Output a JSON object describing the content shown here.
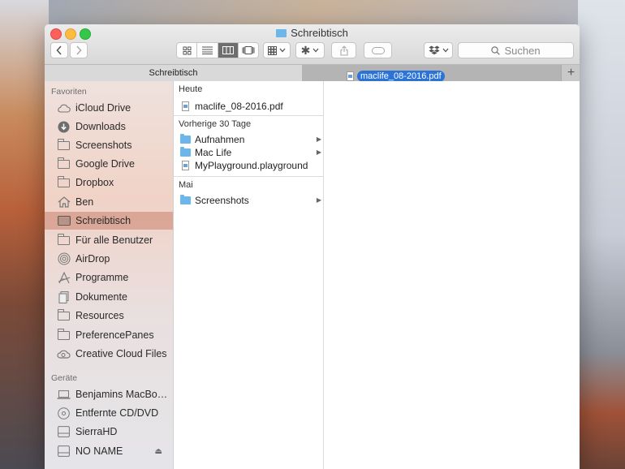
{
  "window": {
    "title": "Schreibtisch"
  },
  "toolbar": {
    "back_icon": "chevron-left-icon",
    "forward_icon": "chevron-right-icon",
    "view_modes": [
      "icon-view-icon",
      "list-view-icon",
      "column-view-icon",
      "coverflow-view-icon"
    ],
    "active_view": "column-view-icon",
    "search_placeholder": "Suchen"
  },
  "tabs": {
    "active_label": "Schreibtisch",
    "dragged_file": "maclife_08-2016.pdf",
    "add_label": "+"
  },
  "sidebar": {
    "favorites_header": "Favoriten",
    "favorites": [
      {
        "label": "iCloud Drive",
        "icon": "cloud-icon"
      },
      {
        "label": "Downloads",
        "icon": "downloads-icon"
      },
      {
        "label": "Screenshots",
        "icon": "folder-icon"
      },
      {
        "label": "Google Drive",
        "icon": "folder-icon"
      },
      {
        "label": "Dropbox",
        "icon": "folder-icon"
      },
      {
        "label": "Ben",
        "icon": "home-icon"
      },
      {
        "label": "Schreibtisch",
        "icon": "desktop-icon",
        "selected": true
      },
      {
        "label": "Für alle Benutzer",
        "icon": "folder-icon"
      },
      {
        "label": "AirDrop",
        "icon": "airdrop-icon"
      },
      {
        "label": "Programme",
        "icon": "applications-icon"
      },
      {
        "label": "Dokumente",
        "icon": "documents-icon"
      },
      {
        "label": "Resources",
        "icon": "folder-icon"
      },
      {
        "label": "PreferencePanes",
        "icon": "folder-icon"
      },
      {
        "label": "Creative Cloud Files",
        "icon": "creative-cloud-icon"
      }
    ],
    "devices_header": "Geräte",
    "devices": [
      {
        "label": "Benjamins MacBo…",
        "icon": "laptop-icon"
      },
      {
        "label": "Entfernte CD/DVD",
        "icon": "disc-icon"
      },
      {
        "label": "SierraHD",
        "icon": "disk-icon"
      },
      {
        "label": "NO NAME",
        "icon": "disk-icon",
        "eject": "⏏"
      }
    ]
  },
  "column1": {
    "today_header": "Heute",
    "today_items": [
      {
        "label": "maclife_08-2016.pdf",
        "kind": "file"
      }
    ],
    "last30_header": "Vorherige 30 Tage",
    "last30_items": [
      {
        "label": "Aufnahmen",
        "kind": "folder",
        "arrow": "▶"
      },
      {
        "label": "Mac Life",
        "kind": "folder",
        "arrow": "▶"
      },
      {
        "label": "MyPlayground.playground",
        "kind": "file"
      }
    ],
    "may_header": "Mai",
    "may_items": [
      {
        "label": "Screenshots",
        "kind": "folder",
        "arrow": "▶"
      }
    ]
  }
}
